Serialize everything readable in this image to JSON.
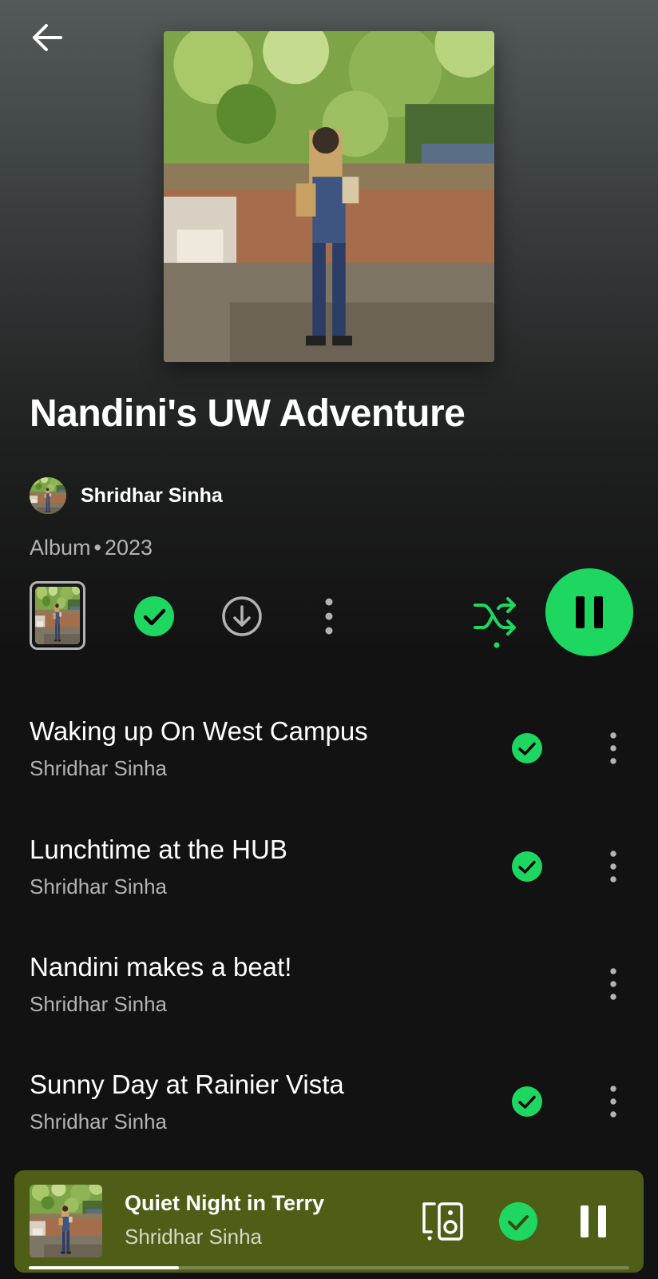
{
  "colors": {
    "accent": "#1ed760",
    "now_playing_bg": "#4e5e17",
    "secondary_text": "#b3b3b3"
  },
  "header": {
    "back_icon": "arrow-left-icon"
  },
  "album": {
    "title": "Nandini's UW Adventure",
    "artist": "Shridhar Sinha",
    "type": "Album",
    "separator": "•",
    "year": "2023"
  },
  "actions": {
    "saved_icon": "check-circle-icon",
    "download_icon": "download-circle-icon",
    "more_icon": "more-vertical-icon",
    "shuffle_icon": "shuffle-icon",
    "shuffle_enabled": true,
    "play_state": "playing",
    "play_icon": "pause-icon"
  },
  "tracks": [
    {
      "title": "Waking up On West Campus",
      "artist": "Shridhar Sinha",
      "saved": true
    },
    {
      "title": "Lunchtime at the HUB",
      "artist": "Shridhar Sinha",
      "saved": true
    },
    {
      "title": "Nandini makes a beat!",
      "artist": "Shridhar Sinha",
      "saved": false
    },
    {
      "title": "Sunny Day at Rainier Vista",
      "artist": "Shridhar Sinha",
      "saved": true
    }
  ],
  "now_playing": {
    "title": "Quiet Night in Terry",
    "artist": "Shridhar Sinha",
    "device_icon": "connect-device-icon",
    "saved": true,
    "play_icon": "pause-icon",
    "progress": 0.25
  }
}
